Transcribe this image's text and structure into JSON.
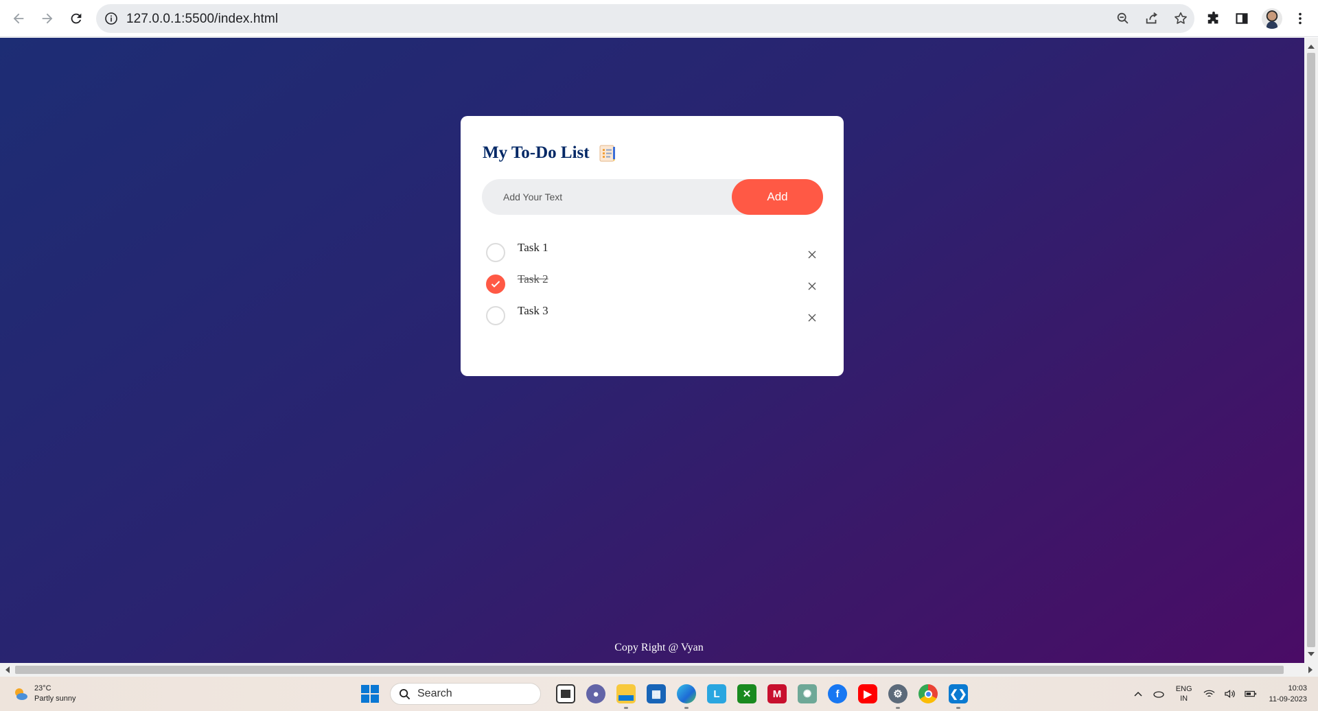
{
  "browser": {
    "url": "127.0.0.1:5500/index.html"
  },
  "app": {
    "title": "My To-Do List",
    "title_icon": "notepad-icon",
    "input_placeholder": "Add Your Text",
    "add_label": "Add",
    "accent_color": "#ff5945",
    "title_color": "#002765",
    "tasks": [
      {
        "label": "Task 1",
        "checked": false
      },
      {
        "label": "Task 2",
        "checked": true
      },
      {
        "label": "Task 3",
        "checked": false
      }
    ],
    "footer": "Copy Right @ Vyan"
  },
  "taskbar": {
    "weather": {
      "temp": "23°C",
      "condition": "Partly sunny"
    },
    "search_label": "Search",
    "apps": [
      "file-manager-icon",
      "teams-chat-icon",
      "file-explorer-icon",
      "microsoft-store-icon",
      "edge-icon",
      "l-app-icon",
      "xbox-icon",
      "mcafee-icon",
      "chatgpt-icon",
      "facebook-icon",
      "youtube-icon",
      "settings-icon",
      "chrome-icon",
      "vscode-icon"
    ],
    "language": {
      "line1": "ENG",
      "line2": "IN"
    },
    "time": "10:03",
    "date": "11-09-2023"
  }
}
